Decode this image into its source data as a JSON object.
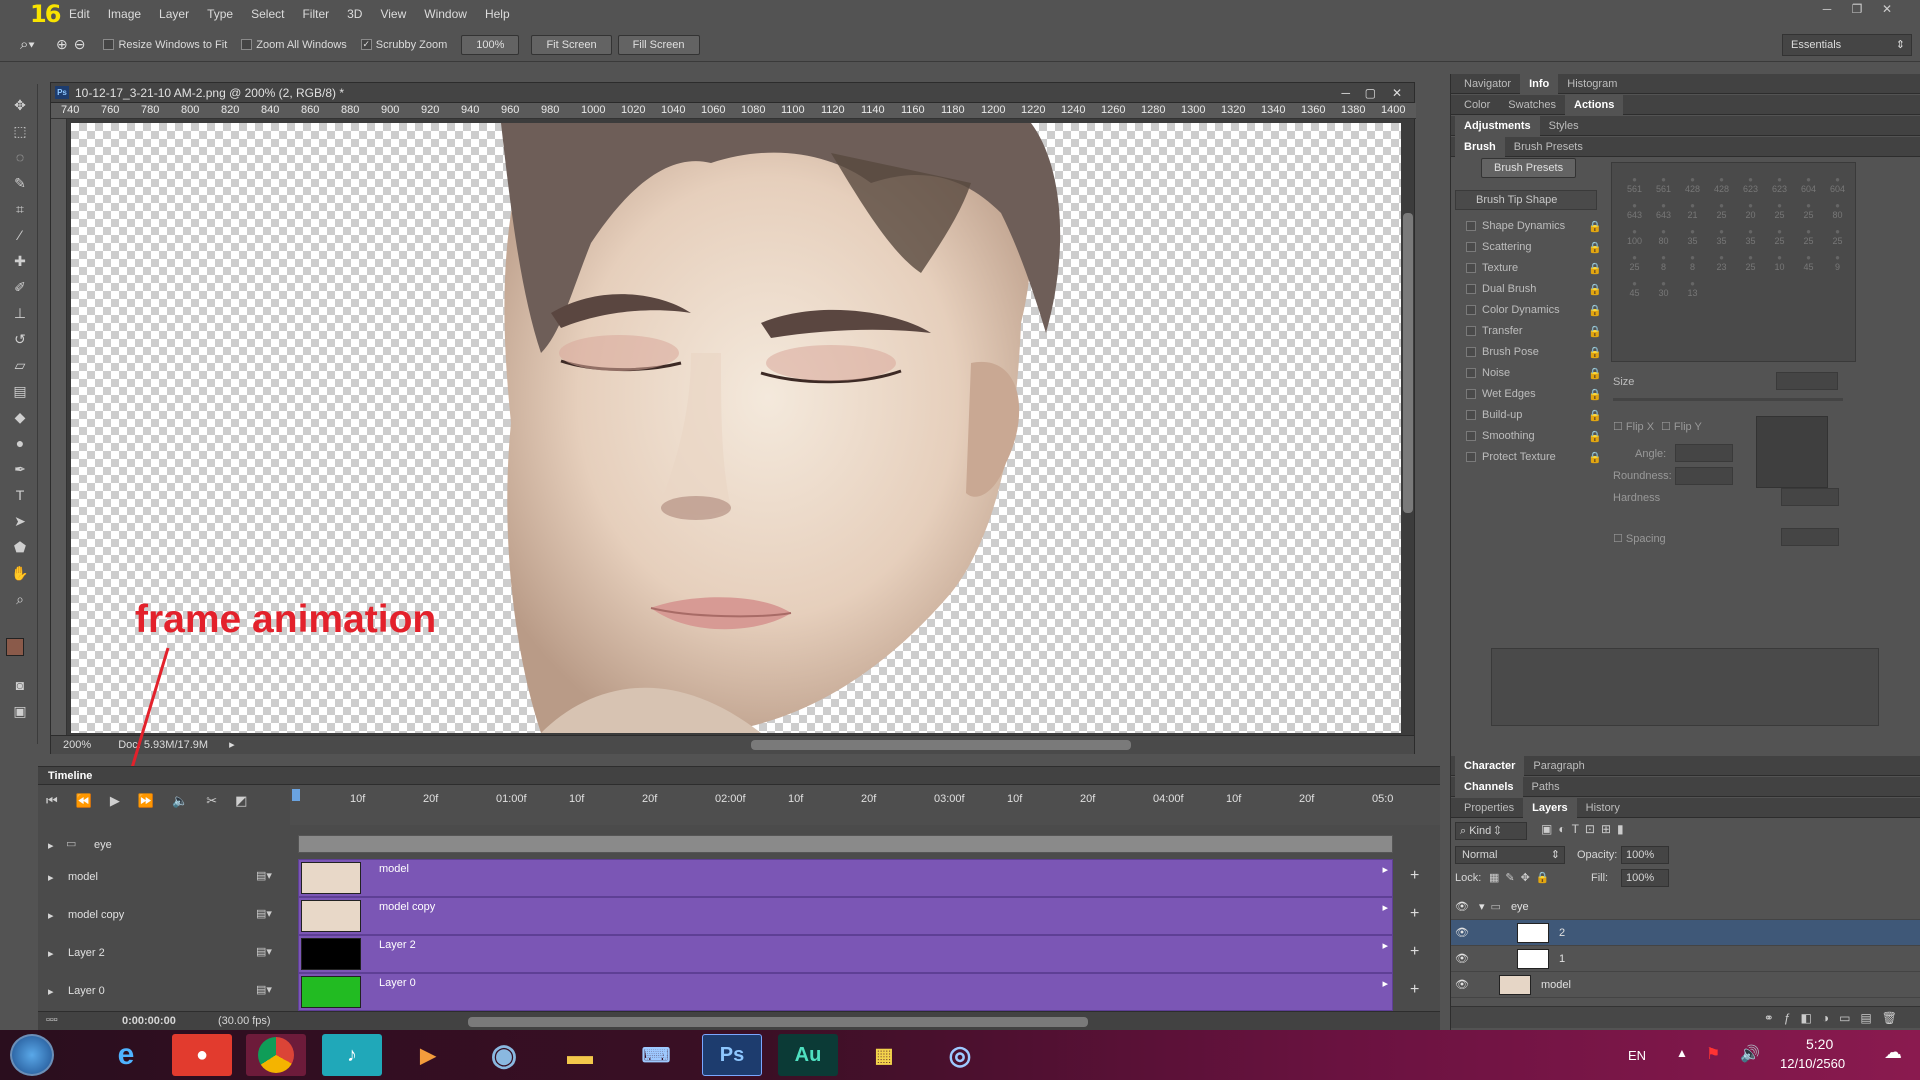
{
  "app": {
    "logo": "16"
  },
  "menu": [
    "Edit",
    "Image",
    "Layer",
    "Type",
    "Select",
    "Filter",
    "3D",
    "View",
    "Window",
    "Help"
  ],
  "options_bar": {
    "resize_windows": "Resize Windows to Fit",
    "zoom_all": "Zoom All Windows",
    "scrubby_zoom": "Scrubby Zoom",
    "zoom_percent": "100%",
    "fit_screen": "Fit Screen",
    "fill_screen": "Fill Screen",
    "workspace": "Essentials"
  },
  "document": {
    "title": "10-12-17_3-21-10 AM-2.png @ 200% (2, RGB/8) *",
    "ruler_ticks": [
      "740",
      "760",
      "780",
      "800",
      "820",
      "840",
      "860",
      "880",
      "900",
      "920",
      "940",
      "960",
      "980",
      "1000",
      "1020",
      "1040",
      "1060",
      "1080",
      "1100",
      "1120",
      "1140",
      "1160",
      "1180",
      "1200",
      "1220",
      "1240",
      "1260",
      "1280",
      "1300",
      "1320",
      "1340",
      "1360",
      "1380",
      "1400"
    ],
    "zoom": "200%",
    "doc_size": "Doc: 5.93M/17.9M"
  },
  "annotation": "frame animation",
  "timeline": {
    "title": "Timeline",
    "ruler": [
      "10f",
      "20f",
      "01:00f",
      "10f",
      "20f",
      "02:00f",
      "10f",
      "20f",
      "03:00f",
      "10f",
      "20f",
      "04:00f",
      "10f",
      "20f",
      "05:0"
    ],
    "current_time": "0:00:00:00",
    "fps": "(30.00 fps)",
    "group": "eye",
    "layers": [
      {
        "name": "model",
        "clip": "model"
      },
      {
        "name": "model copy",
        "clip": "model copy"
      },
      {
        "name": "Layer 2",
        "clip": "Layer 2"
      },
      {
        "name": "Layer 0",
        "clip": "Layer 0"
      }
    ]
  },
  "panels": {
    "row1": [
      "Navigator",
      "Info",
      "Histogram"
    ],
    "row2": [
      "Color",
      "Swatches",
      "Actions"
    ],
    "row3": [
      "Adjustments",
      "Styles"
    ],
    "row4": [
      "Brush",
      "Brush Presets"
    ],
    "brush_presets_btn": "Brush Presets",
    "brush_tip_shape": "Brush Tip Shape",
    "brush_options": [
      "Shape Dynamics",
      "Scattering",
      "Texture",
      "Dual Brush",
      "Color Dynamics",
      "Transfer",
      "Brush Pose",
      "Noise",
      "Wet Edges",
      "Build-up",
      "Smoothing",
      "Protect Texture"
    ],
    "brush_sizes": [
      "561",
      "561",
      "428",
      "428",
      "623",
      "623",
      "604",
      "604",
      "643",
      "643",
      "21",
      "25",
      "20",
      "25",
      "25",
      "80",
      "100",
      "80",
      "35",
      "35",
      "35",
      "25",
      "25",
      "25",
      "25",
      "8",
      "8",
      "23",
      "25",
      "10",
      "45",
      "9",
      "45",
      "30",
      "13"
    ],
    "size_label": "Size",
    "flip_x": "Flip X",
    "flip_y": "Flip Y",
    "angle": "Angle:",
    "roundness": "Roundness:",
    "hardness": "Hardness",
    "spacing": "Spacing",
    "row5": [
      "Character",
      "Paragraph"
    ],
    "row6": [
      "Channels",
      "Paths"
    ],
    "row7": [
      "Properties",
      "Layers",
      "History"
    ]
  },
  "layers_panel": {
    "kind": "Kind",
    "blend_mode": "Normal",
    "opacity_label": "Opacity:",
    "opacity": "100%",
    "lock_label": "Lock:",
    "fill_label": "Fill:",
    "fill": "100%",
    "items": [
      {
        "name": "eye"
      },
      {
        "name": "2"
      },
      {
        "name": "1"
      },
      {
        "name": "model"
      }
    ]
  },
  "taskbar": {
    "lang": "EN",
    "time": "5:20",
    "date": "12/10/2560",
    "ps_label": "Ps",
    "au_label": "Au"
  }
}
